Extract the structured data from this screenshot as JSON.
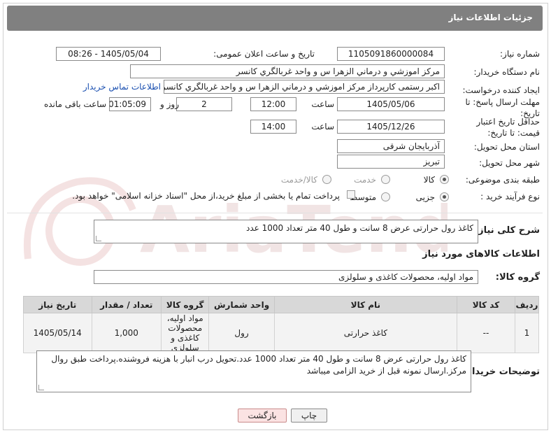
{
  "header": {
    "title": "جزئیات اطلاعات نیاز"
  },
  "fields": {
    "need_number_label": "شماره نیاز:",
    "need_number": "1105091860000084",
    "announce_label": "تاریخ و ساعت اعلان عمومی:",
    "announce_value": "1405/05/04 - 08:26",
    "buyer_org_label": "نام دستگاه خریدار:",
    "buyer_org": "مرکز اموزشي و درماني الزهرا س  و واحد غربالگري کانسر",
    "requester_label": "ایجاد کننده درخواست:",
    "requester": "اکبر رستمی کارپرداز مرکز اموزشي و درماني الزهرا س  و واحد غربالگري کانسر",
    "buyer_contact_link": "اطلاعات تماس خریدار",
    "reply_deadline_label": "مهلت ارسال پاسخ: تا تاریخ:",
    "reply_date": "1405/05/06",
    "time_label": "ساعت",
    "reply_time": "12:00",
    "days_count": "2",
    "days_label": "روز و",
    "remaining_time": "01:05:09",
    "remaining_label": "ساعت باقی مانده",
    "price_validity_label": "حداقل تاریخ اعتبار قیمت: تا تاریخ:",
    "price_date": "1405/12/26",
    "price_time": "14:00",
    "province_label": "استان محل تحویل:",
    "province": "آذربایجان شرقی",
    "city_label": "شهر محل تحویل:",
    "city": "تبریز",
    "category_label": "طبقه بندی موضوعی:",
    "category_options": [
      "کالا",
      "خدمت",
      "کالا/خدمت"
    ],
    "process_label": "نوع فرآیند خرید :",
    "process_options": [
      "جزیی",
      "متوسط"
    ],
    "payment_note": "پرداخت تمام یا بخشی از مبلغ خرید،از محل \"اسناد خزانه اسلامی\" خواهد بود."
  },
  "summary": {
    "label": "شرح کلی نیاز:",
    "text": "کاغذ رول حرارتی عرض 8 سانت و طول 40 متر تعداد 1000 عدد"
  },
  "goods_section": {
    "title": "اطلاعات کالاهای مورد نیاز",
    "group_label": "گروه کالا:",
    "group_value": "مواد اولیه، محصولات کاغذی و سلولزی"
  },
  "table": {
    "headers": [
      "ردیف",
      "کد کالا",
      "نام کالا",
      "واحد شمارش",
      "گروه کالا",
      "تعداد / مقدار",
      "تاریخ نیاز"
    ],
    "rows": [
      {
        "index": "1",
        "code": "--",
        "name": "کاغذ حرارتی",
        "unit": "رول",
        "group_l1": "مواد اولیه،",
        "group_l2": "محصولات کاغذی و",
        "group_l3": "سلولزی",
        "qty": "1,000",
        "date": "1405/05/14"
      }
    ]
  },
  "buyer_notes": {
    "label": "توضیحات خریدار:",
    "line1": "کاغذ رول حرارتی عرض 8 سانت و طول 40 متر تعداد 1000 عدد.تحویل درب انبار با هزینه فروشنده.پرداخت طبق روال",
    "line2": "مرکز.ارسال نمونه قبل از خرید الزامی میباشد"
  },
  "buttons": {
    "print": "چاپ",
    "back": "بازگشت"
  },
  "colors": {
    "header_bg": "#808080",
    "link": "#1a4fb0",
    "back_bg": "#fbe3e3"
  }
}
